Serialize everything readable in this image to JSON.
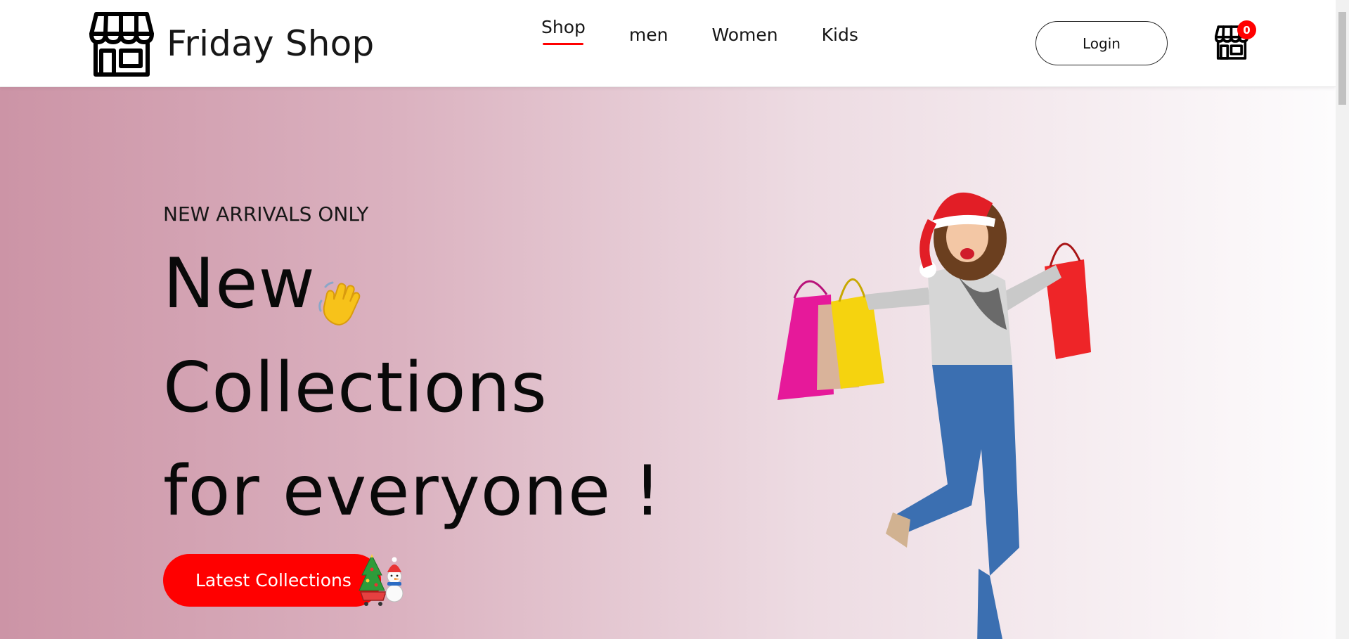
{
  "brand": {
    "name": "Friday Shop"
  },
  "nav": {
    "items": [
      {
        "label": "Shop",
        "active": true
      },
      {
        "label": "men",
        "active": false
      },
      {
        "label": "Women",
        "active": false
      },
      {
        "label": "Kids",
        "active": false
      }
    ]
  },
  "header": {
    "login_label": "Login",
    "cart_count": "0"
  },
  "hero": {
    "tagline": "NEW ARRIVALS ONLY",
    "title_line1": "New",
    "title_line2": "Collections",
    "title_line3": "for everyone !",
    "cta_label": "Latest Collections"
  },
  "colors": {
    "accent": "#ff0000",
    "hero_gradient_start": "#cc94a6",
    "hero_gradient_end": "#fdfcfd"
  },
  "icons": {
    "logo": "shop-storefront-icon",
    "cart": "shop-storefront-icon",
    "wave": "waving-hand-icon",
    "cta_decoration": "christmas-tree-snowman-cart-icon"
  }
}
